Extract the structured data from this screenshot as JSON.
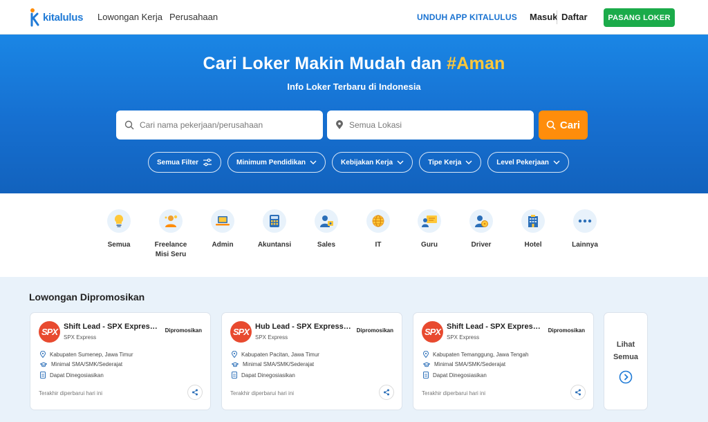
{
  "brand": {
    "name": "kitalulus",
    "color_primary": "#1f7ad6",
    "color_accent": "#ffc83a",
    "color_green": "#1bab4a",
    "color_orange": "#ff8d0b"
  },
  "nav": {
    "links": [
      "Lowongan Kerja",
      "Perusahaan"
    ],
    "unduh": "UNDUH APP KITALULUS",
    "masuk": "Masuk",
    "daftar": "Daftar",
    "pasang": "PASANG LOKER"
  },
  "hero": {
    "title_main": "Cari Loker Makin Mudah dan ",
    "title_accent": "#Aman",
    "subtitle": "Info Loker Terbaru di Indonesia",
    "search_placeholder": "Cari nama pekerjaan/perusahaan",
    "location_placeholder": "Semua Lokasi",
    "search_button": "Cari",
    "filters": [
      "Semua Filter",
      "Minimum Pendidikan",
      "Kebijakan Kerja",
      "Tipe Kerja",
      "Level Pekerjaan"
    ]
  },
  "categories": [
    {
      "label": "Semua",
      "icon": "lightbulb-icon"
    },
    {
      "label": "Freelance Misi Seru",
      "icon": "freelance-icon"
    },
    {
      "label": "Admin",
      "icon": "laptop-icon"
    },
    {
      "label": "Akuntansi",
      "icon": "calculator-icon"
    },
    {
      "label": "Sales",
      "icon": "sales-icon"
    },
    {
      "label": "IT",
      "icon": "globe-icon"
    },
    {
      "label": "Guru",
      "icon": "teacher-icon"
    },
    {
      "label": "Driver",
      "icon": "driver-icon"
    },
    {
      "label": "Hotel",
      "icon": "hotel-icon"
    },
    {
      "label": "Lainnya",
      "icon": "more-icon"
    }
  ],
  "promoted": {
    "title": "Lowongan Dipromosikan",
    "see_all_line1": "Lihat",
    "see_all_line2": "Semua",
    "jobs": [
      {
        "title": "Shift Lead - SPX Express (...",
        "company": "SPX Express",
        "badge": "Dipromosikan",
        "location": "Kabupaten Sumenep, Jawa Timur",
        "education": "Minimal SMA/SMK/Sederajat",
        "salary": "Dapat Dinegosiasikan",
        "updated": "Terakhir diperbarui hari ini",
        "logo": "SPX"
      },
      {
        "title": "Hub Lead - SPX Express (...",
        "company": "SPX Express",
        "badge": "Dipromosikan",
        "location": "Kabupaten Pacitan, Jawa Timur",
        "education": "Minimal SMA/SMK/Sederajat",
        "salary": "Dapat Dinegosiasikan",
        "updated": "Terakhir diperbarui hari ini",
        "logo": "SPX"
      },
      {
        "title": "Shift Lead - SPX Express (...",
        "company": "SPX Express",
        "badge": "Dipromosikan",
        "location": "Kabupaten Temanggung, Jawa Tengah",
        "education": "Minimal SMA/SMK/Sederajat",
        "salary": "Dapat Dinegosiasikan",
        "updated": "Terakhir diperbarui hari ini",
        "logo": "SPX"
      }
    ]
  }
}
